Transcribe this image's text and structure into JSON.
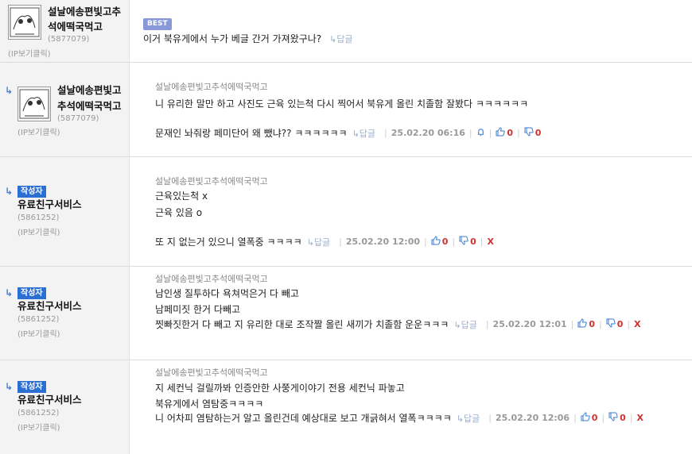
{
  "comments": [
    {
      "nick_lines": [
        "설날에송편빛고추",
        "석에떡국먹고"
      ],
      "uid": "(5877079)",
      "ip_label": "(IP보기클릭)",
      "badge": "BEST",
      "lines": [
        "이거 북유게에서 누가 베글 간거 가져왔구나?"
      ],
      "reply_label": "↳답글"
    },
    {
      "reply_marker": "↳",
      "nick_lines": [
        "설날에송편빛고",
        "추석에떡국먹고"
      ],
      "uid": "(5877079)",
      "ip_label": "(IP보기클릭)",
      "reply_to": "설날에송편빛고추석에떡국먹고",
      "lines": [
        "니 유리한 말만 하고 사진도 근육 있는척 다시 찍어서 북유게 올린 치졸함 잘봤다 ㅋㅋㅋㅋㅋㅋ",
        "",
        "문재인 놔줘랑 페미단어 왜 뺐냐?? ㅋㅋㅋㅋㅋㅋ"
      ],
      "reply_label": "↳답글",
      "date": "25.02.20 06:16",
      "bell_icon": "bell-icon",
      "up": "0",
      "down": "0"
    },
    {
      "reply_marker": "↳",
      "writer_badge": "작성자",
      "nick_lines": [
        "유료친구서비스"
      ],
      "uid": "(5861252)",
      "ip_label": "(IP보기클릭)",
      "reply_to": "설날에송편빛고추석에떡국먹고",
      "lines": [
        "근육있는척 x",
        "근육 있음 o",
        "",
        "또 지 없는거 있으니 열폭중 ㅋㅋㅋㅋ"
      ],
      "reply_label": "↳답글",
      "date": "25.02.20 12:00",
      "up": "0",
      "down": "0",
      "delete": "X"
    },
    {
      "reply_marker": "↳",
      "writer_badge": "작성자",
      "nick_lines": [
        "유료친구서비스"
      ],
      "uid": "(5861252)",
      "ip_label": "(IP보기클릭)",
      "reply_to": "설날에송편빛고추석에떡국먹고",
      "lines": [
        "남인생 질투하다 욕쳐먹은거 다 빼고",
        "남페미짓 한거 다빼고",
        "찟빠짓한거 다 빼고 지 유리한 대로 조작짤 올린 새끼가 치졸함 운운ㅋㅋㅋ"
      ],
      "reply_label": "↳답글",
      "date": "25.02.20 12:01",
      "up": "0",
      "down": "0",
      "delete": "X"
    },
    {
      "reply_marker": "↳",
      "writer_badge": "작성자",
      "nick_lines": [
        "유료친구서비스"
      ],
      "uid": "(5861252)",
      "ip_label": "(IP보기클릭)",
      "reply_to": "설날에송편빛고추석에떡국먹고",
      "lines": [
        "지 세컨닉 걸릴까봐 인증안한 사쭝게이야기 전용 세컨닉 파놓고",
        "북유게에서 염탐중ㅋㅋㅋㅋ",
        "니 어차피 염탐하는거 알고 올린건데 예상대로 보고 개긁혀서 열폭ㅋㅋㅋㅋ"
      ],
      "reply_label": "↳답글",
      "date": "25.02.20 12:06",
      "up": "0",
      "down": "0",
      "delete": "X"
    }
  ]
}
